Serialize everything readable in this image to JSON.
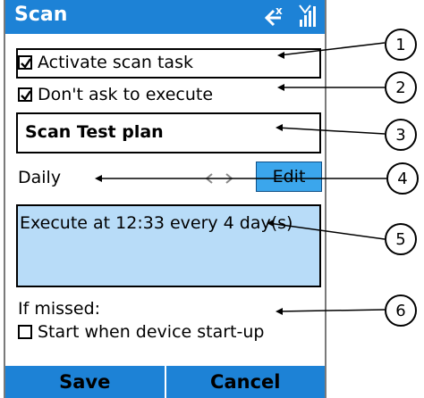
{
  "titlebar": {
    "title": "Scan"
  },
  "options": {
    "activate_label": "Activate scan task",
    "activate_checked": true,
    "dontask_label": "Don't ask to execute",
    "dontask_checked": true
  },
  "plan_name": "Scan Test plan",
  "schedule": {
    "frequency": "Daily",
    "edit_label": "Edit",
    "description": "Execute at 12:33 every 4 day(s)"
  },
  "missed": {
    "label": "If missed:",
    "startup_label": "Start when device start-up",
    "startup_checked": false
  },
  "softkeys": {
    "left": "Save",
    "right": "Cancel"
  },
  "callouts": [
    "1",
    "2",
    "3",
    "4",
    "5",
    "6"
  ],
  "colors": {
    "titlebar": "#1d82d6",
    "schedule_bg": "#b8dcf8",
    "edit_bg": "#3ba6ec"
  }
}
